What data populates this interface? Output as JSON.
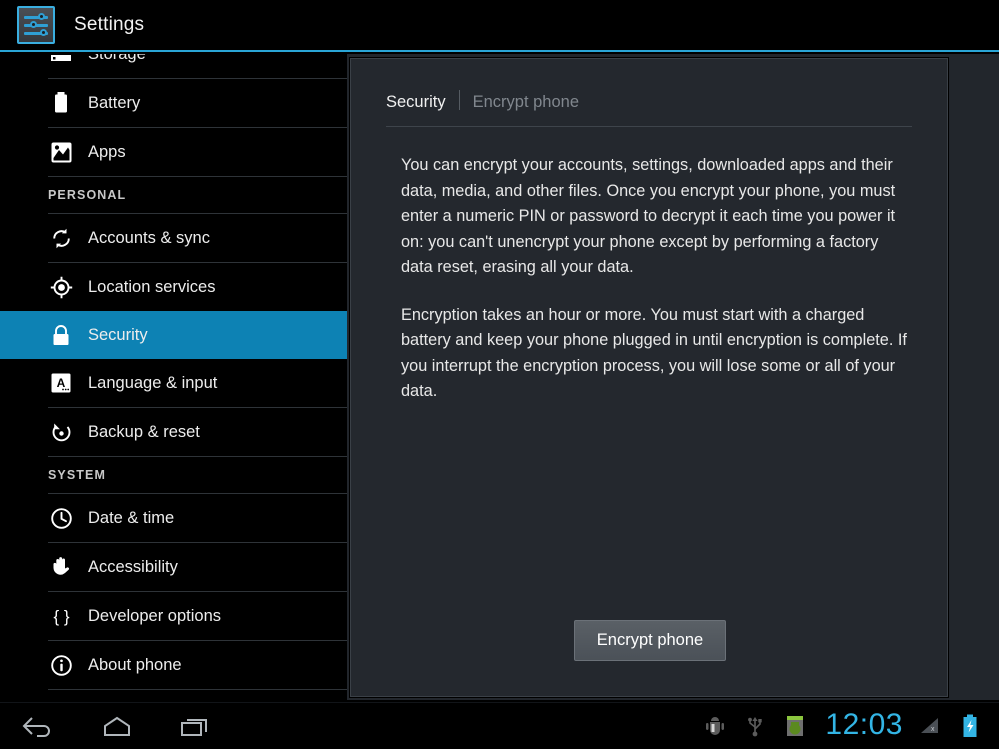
{
  "titlebar": {
    "title": "Settings",
    "icon": "settings-sliders-icon",
    "accent_color": "#2aa5d6"
  },
  "sidebar": {
    "selected_accent_color": "#0d82b4",
    "items": [
      {
        "label": "Storage",
        "icon": "storage-icon",
        "type": "item",
        "selected": false
      },
      {
        "label": "Battery",
        "icon": "battery-icon",
        "type": "item",
        "selected": false
      },
      {
        "label": "Apps",
        "icon": "apps-icon",
        "type": "item",
        "selected": false
      },
      {
        "label": "PERSONAL",
        "icon": "",
        "type": "header",
        "selected": false
      },
      {
        "label": "Accounts & sync",
        "icon": "sync-icon",
        "type": "item",
        "selected": false
      },
      {
        "label": "Location services",
        "icon": "location-icon",
        "type": "item",
        "selected": false
      },
      {
        "label": "Security",
        "icon": "lock-icon",
        "type": "item",
        "selected": true
      },
      {
        "label": "Language & input",
        "icon": "language-icon",
        "type": "item",
        "selected": false
      },
      {
        "label": "Backup & reset",
        "icon": "backup-reset-icon",
        "type": "item",
        "selected": false
      },
      {
        "label": "SYSTEM",
        "icon": "",
        "type": "header",
        "selected": false
      },
      {
        "label": "Date & time",
        "icon": "clock-icon",
        "type": "item",
        "selected": false
      },
      {
        "label": "Accessibility",
        "icon": "hand-icon",
        "type": "item",
        "selected": false
      },
      {
        "label": "Developer options",
        "icon": "braces-icon",
        "type": "item",
        "selected": false
      },
      {
        "label": "About phone",
        "icon": "info-icon",
        "type": "item",
        "selected": false
      }
    ]
  },
  "panel": {
    "breadcrumb_current": "Security",
    "breadcrumb_sub": "Encrypt phone",
    "paragraphs": [
      "You can encrypt your accounts, settings, downloaded apps and their data, media, and other files. Once you encrypt your phone, you must enter a numeric PIN or password to decrypt it each time you power it on: you can't unencrypt your phone except by performing a factory data reset, erasing all your data.",
      "Encryption takes an hour or more. You must start with a charged battery and keep your phone plugged in until encryption is complete. If you interrupt the encryption process, you will lose some or all of your data."
    ],
    "button_label": "Encrypt phone"
  },
  "navbar": {
    "back_icon": "back-arrow-icon",
    "home_icon": "home-icon",
    "recents_icon": "recent-apps-icon",
    "status_icons": [
      "adb-debug-icon",
      "usb-icon",
      "system-update-icon",
      "no-signal-icon",
      "battery-charging-icon"
    ],
    "clock": "12:03",
    "clock_color": "#33b5e5"
  }
}
